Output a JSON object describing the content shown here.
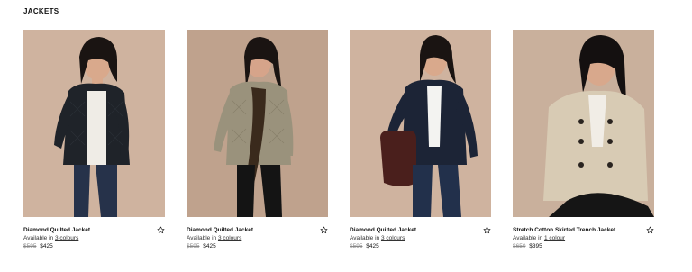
{
  "section": {
    "title": "JACKETS"
  },
  "colors": {
    "backdrop_warm": "#cfb39f",
    "backdrop_taupe": "#bfa28d",
    "text": "#111111",
    "muted": "#8a8a8a"
  },
  "products": [
    {
      "name": "Diamond Quilted Jacket",
      "available_prefix": "Available in",
      "colours_link": "3 colours",
      "original_price": "$595",
      "sale_price": "$425",
      "favorite_icon": "star-outline-icon",
      "jacket_color": "#1f2329"
    },
    {
      "name": "Diamond Quilted Jacket",
      "available_prefix": "Available in",
      "colours_link": "3 colours",
      "original_price": "$595",
      "sale_price": "$425",
      "favorite_icon": "star-outline-icon",
      "jacket_color": "#9a927c"
    },
    {
      "name": "Diamond Quilted Jacket",
      "available_prefix": "Available in",
      "colours_link": "3 colours",
      "original_price": "$595",
      "sale_price": "$425",
      "favorite_icon": "star-outline-icon",
      "jacket_color": "#1c2436"
    },
    {
      "name": "Stretch Cotton Skirted Trench Jacket",
      "available_prefix": "Available in",
      "colours_link": "1 colour",
      "original_price": "$650",
      "sale_price": "$395",
      "favorite_icon": "star-outline-icon",
      "jacket_color": "#d8cbb4"
    }
  ]
}
